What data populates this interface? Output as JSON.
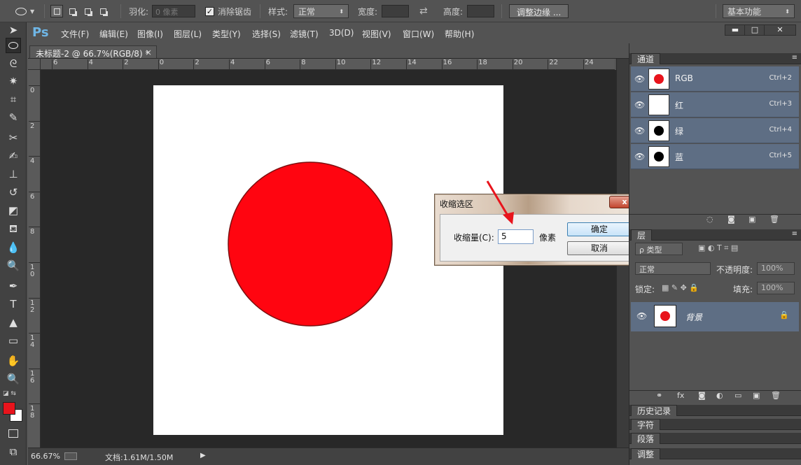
{
  "options_bar": {
    "feather_label": "羽化:",
    "feather_value": "0 像素",
    "antialias_label": "消除锯齿",
    "style_label": "样式:",
    "style_value": "正常",
    "width_label": "宽度:",
    "height_label": "高度:",
    "refine_edge_button": "调整边缘 ...",
    "workspace_value": "基本功能"
  },
  "menu": {
    "logo": "Ps",
    "items": [
      "文件(F)",
      "编辑(E)",
      "图像(I)",
      "图层(L)",
      "类型(Y)",
      "选择(S)",
      "滤镜(T)",
      "3D(D)",
      "视图(V)",
      "窗口(W)",
      "帮助(H)"
    ],
    "window_buttons": [
      "▬",
      "□",
      "✕"
    ]
  },
  "document": {
    "tab_title": "未标题-2 @ 66.7%(RGB/8) *",
    "tab_close": "×",
    "circle_color": "#ff0510",
    "circle_stroke": "#7a0f0f"
  },
  "ruler": {
    "top_labels": [
      "6",
      "4",
      "2",
      "0",
      "2",
      "4",
      "6",
      "8",
      "10",
      "12",
      "14",
      "16",
      "18",
      "20",
      "22",
      "24",
      "2"
    ],
    "left_labels": [
      "0",
      "2",
      "4",
      "6",
      "8",
      "10",
      "12",
      "14",
      "16",
      "18"
    ]
  },
  "status_bar": {
    "zoom": "66.67%",
    "doc_info": "文档:1.61M/1.50M",
    "arrow": "▶"
  },
  "dialog": {
    "title": "收缩选区",
    "close": "x",
    "label": "收缩量(C):",
    "value": "5",
    "unit": "像素",
    "ok": "确定",
    "cancel": "取消"
  },
  "channels_panel": {
    "tab": "通道",
    "rows": [
      {
        "name": "RGB",
        "shortcut": "Ctrl+2",
        "dot": "#e8141c"
      },
      {
        "name": "红",
        "shortcut": "Ctrl+3",
        "dot": "#ffffff"
      },
      {
        "name": "绿",
        "shortcut": "Ctrl+4",
        "dot": "#000000"
      },
      {
        "name": "蓝",
        "shortcut": "Ctrl+5",
        "dot": "#000000"
      }
    ]
  },
  "layers_panel": {
    "tab": "层",
    "filter_value": "ρ 类型",
    "blend_value": "正常",
    "opacity_label": "不透明度:",
    "opacity_value": "100%",
    "lock_label": "锁定:",
    "fill_label": "填充:",
    "fill_value": "100%",
    "layer_name": "背景"
  },
  "collapsed_panels": [
    "历史记录",
    "字符",
    "段落",
    "调整"
  ],
  "colors": {
    "foreground": "#e8141c",
    "background": "#ffffff"
  }
}
